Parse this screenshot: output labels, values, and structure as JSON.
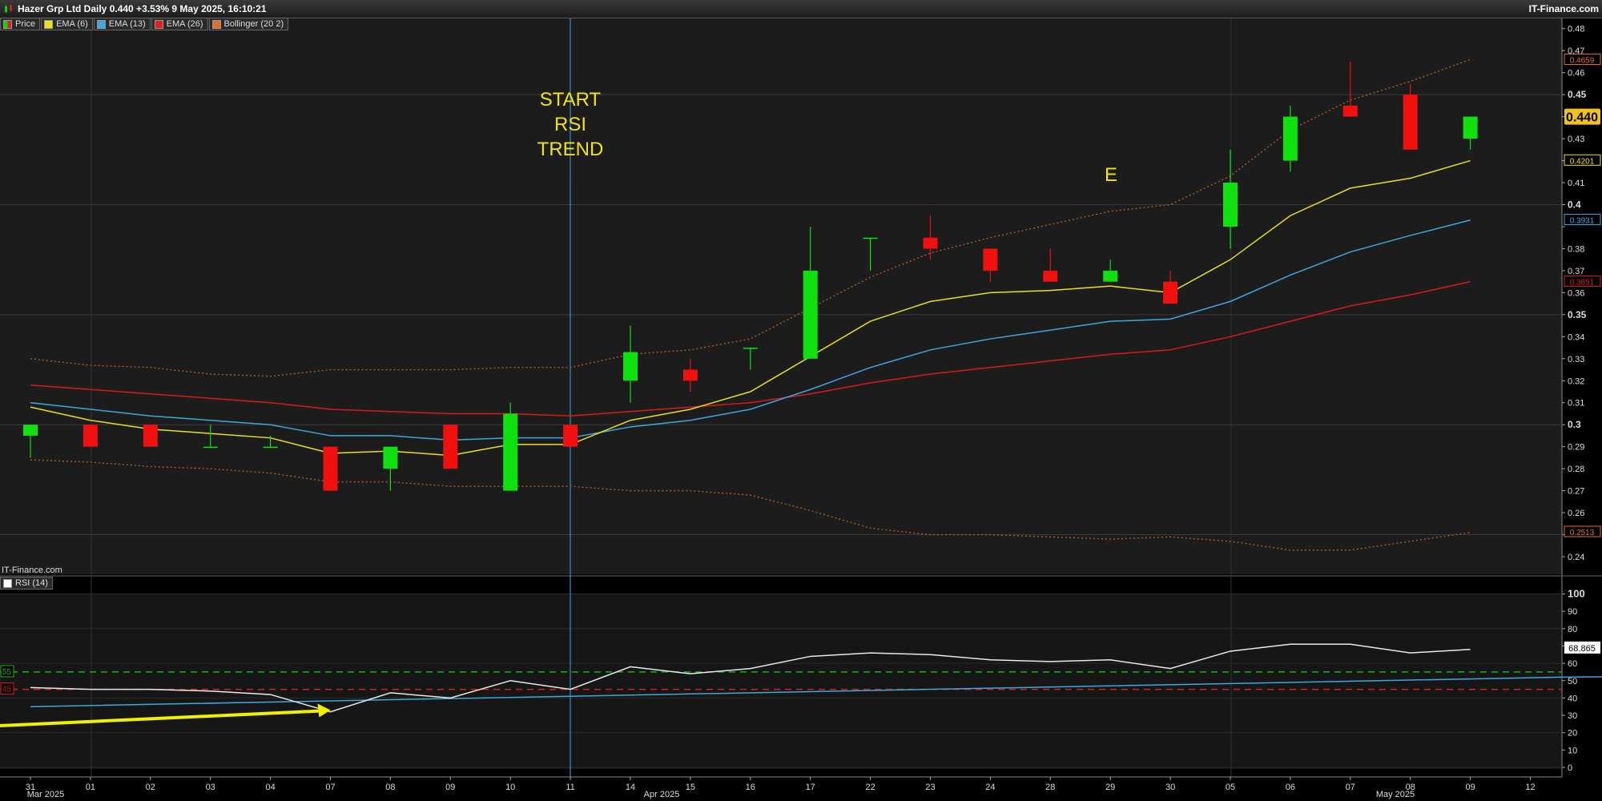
{
  "header": {
    "title": "Hazer Grp Ltd Daily 0.440 +3.53% 9 May 2025, 16:10:21",
    "brand": "IT-Finance.com"
  },
  "watermark": "IT-Finance.com",
  "legend": [
    {
      "label": "Price",
      "color": "#e0201f"
    },
    {
      "label": "EMA (6)",
      "color": "#f0e020"
    },
    {
      "label": "EMA (13)",
      "color": "#3fa8e0"
    },
    {
      "label": "EMA (26)",
      "color": "#e0201f"
    },
    {
      "label": "Bollinger (20 2)",
      "color": "#e07030"
    }
  ],
  "rsi_legend": {
    "label": "RSI (14)",
    "color": "#ffffff"
  },
  "annotations": {
    "start_line1": "START",
    "start_line2": "RSI",
    "start_line3": "TREND",
    "e_label": "E"
  },
  "colors": {
    "up": "#10e010",
    "down": "#f01010",
    "ema6": "#e8dc28",
    "ema13": "#3ea6de",
    "ema26": "#d81818",
    "bollinger": "#b05a28",
    "rsi": "#e8e8e8",
    "arrow": "#f0f000",
    "level55": "#18b018",
    "level45": "#d02020"
  },
  "chart_data": {
    "type": "candlestick",
    "title": "Hazer Grp Ltd Daily 0.440 +3.53% 9 May 2025, 16:10:21",
    "x_tick_labels": [
      "31",
      "01",
      "02",
      "03",
      "04",
      "07",
      "08",
      "09",
      "10",
      "11",
      "14",
      "15",
      "16",
      "17",
      "22",
      "23",
      "24",
      "28",
      "29",
      "30",
      "05",
      "06",
      "07",
      "08",
      "09",
      "12"
    ],
    "month_labels": [
      "Mar 2025",
      "Apr 2025",
      "May 2025"
    ],
    "price_axis": {
      "ylim": [
        0.232,
        0.485
      ],
      "ticks": [
        0.24,
        0.25,
        0.26,
        0.27,
        0.28,
        0.29,
        0.3,
        0.31,
        0.32,
        0.33,
        0.34,
        0.35,
        0.36,
        0.37,
        0.38,
        0.39,
        0.4,
        0.41,
        0.42,
        0.43,
        0.44,
        0.45,
        0.46,
        0.47,
        0.48
      ],
      "tick_labels": [
        "0.24",
        "",
        "0.26",
        "0.27",
        "0.28",
        "0.29",
        "0.3",
        "0.31",
        "0.32",
        "0.33",
        "0.34",
        "0.35",
        "0.36",
        "0.37",
        "0.38",
        "",
        "0.4",
        "0.41",
        "",
        "0.43",
        "",
        "0.45",
        "0.46",
        "0.47",
        "0.48"
      ],
      "bold_ticks": [
        0.3,
        0.35,
        0.4,
        0.45
      ],
      "grid_lines": [
        0.25,
        0.3,
        0.35,
        0.4,
        0.45
      ],
      "value_tags": [
        {
          "value": 0.4659,
          "text": "0.4659",
          "color": "#e07030",
          "style": "outline"
        },
        {
          "value": 0.44,
          "text": "0.440",
          "color": "#f0c020",
          "style": "filled"
        },
        {
          "value": 0.4201,
          "text": "0.4201",
          "color": "#f0e020",
          "style": "outline"
        },
        {
          "value": 0.3931,
          "text": "0.3931",
          "color": "#3fa8e0",
          "style": "outline"
        },
        {
          "value": 0.3651,
          "text": "0.3651",
          "color": "#e02020",
          "style": "outline"
        },
        {
          "value": 0.2513,
          "text": "0.2513",
          "color": "#e07030",
          "style": "outline"
        }
      ]
    },
    "candles": [
      {
        "date": "31",
        "open": 0.295,
        "high": 0.3,
        "low": 0.285,
        "close": 0.3
      },
      {
        "date": "01",
        "open": 0.3,
        "high": 0.3,
        "low": 0.29,
        "close": 0.29
      },
      {
        "date": "02",
        "open": 0.3,
        "high": 0.3,
        "low": 0.29,
        "close": 0.29
      },
      {
        "date": "03",
        "open": 0.29,
        "high": 0.3,
        "low": 0.29,
        "close": 0.29
      },
      {
        "date": "04",
        "open": 0.29,
        "high": 0.295,
        "low": 0.29,
        "close": 0.29
      },
      {
        "date": "07",
        "open": 0.29,
        "high": 0.29,
        "low": 0.27,
        "close": 0.27
      },
      {
        "date": "08",
        "open": 0.28,
        "high": 0.29,
        "low": 0.27,
        "close": 0.29
      },
      {
        "date": "09",
        "open": 0.3,
        "high": 0.3,
        "low": 0.28,
        "close": 0.28
      },
      {
        "date": "10",
        "open": 0.27,
        "high": 0.31,
        "low": 0.27,
        "close": 0.305
      },
      {
        "date": "11",
        "open": 0.3,
        "high": 0.3,
        "low": 0.29,
        "close": 0.29
      },
      {
        "date": "14",
        "open": 0.32,
        "high": 0.345,
        "low": 0.31,
        "close": 0.333
      },
      {
        "date": "15",
        "open": 0.325,
        "high": 0.33,
        "low": 0.315,
        "close": 0.32
      },
      {
        "date": "16",
        "open": 0.335,
        "high": 0.335,
        "low": 0.325,
        "close": 0.335
      },
      {
        "date": "17",
        "open": 0.33,
        "high": 0.39,
        "low": 0.33,
        "close": 0.37
      },
      {
        "date": "22",
        "open": 0.385,
        "high": 0.385,
        "low": 0.37,
        "close": 0.385
      },
      {
        "date": "23",
        "open": 0.385,
        "high": 0.395,
        "low": 0.375,
        "close": 0.38
      },
      {
        "date": "24",
        "open": 0.38,
        "high": 0.38,
        "low": 0.365,
        "close": 0.37
      },
      {
        "date": "28",
        "open": 0.37,
        "high": 0.38,
        "low": 0.365,
        "close": 0.365
      },
      {
        "date": "29",
        "open": 0.365,
        "high": 0.375,
        "low": 0.365,
        "close": 0.37
      },
      {
        "date": "30",
        "open": 0.365,
        "high": 0.37,
        "low": 0.355,
        "close": 0.355
      },
      {
        "date": "05",
        "open": 0.39,
        "high": 0.425,
        "low": 0.38,
        "close": 0.41
      },
      {
        "date": "06",
        "open": 0.42,
        "high": 0.445,
        "low": 0.415,
        "close": 0.44
      },
      {
        "date": "07",
        "open": 0.445,
        "high": 0.465,
        "low": 0.44,
        "close": 0.44
      },
      {
        "date": "08",
        "open": 0.45,
        "high": 0.455,
        "low": 0.425,
        "close": 0.425
      },
      {
        "date": "09",
        "open": 0.43,
        "high": 0.44,
        "low": 0.425,
        "close": 0.44
      }
    ],
    "ema6": [
      0.308,
      0.302,
      0.298,
      0.296,
      0.294,
      0.287,
      0.288,
      0.286,
      0.291,
      0.291,
      0.302,
      0.307,
      0.315,
      0.331,
      0.347,
      0.356,
      0.36,
      0.361,
      0.363,
      0.36,
      0.375,
      0.395,
      0.4075,
      0.412,
      0.42
    ],
    "ema13": [
      0.31,
      0.307,
      0.304,
      0.302,
      0.3,
      0.295,
      0.295,
      0.293,
      0.294,
      0.294,
      0.299,
      0.302,
      0.307,
      0.316,
      0.326,
      0.334,
      0.339,
      0.343,
      0.347,
      0.348,
      0.356,
      0.368,
      0.3785,
      0.386,
      0.393
    ],
    "ema26": [
      0.318,
      0.316,
      0.314,
      0.312,
      0.31,
      0.307,
      0.306,
      0.305,
      0.305,
      0.304,
      0.306,
      0.308,
      0.31,
      0.314,
      0.319,
      0.323,
      0.326,
      0.329,
      0.332,
      0.334,
      0.34,
      0.347,
      0.354,
      0.359,
      0.365
    ],
    "bollinger_upper": [
      0.33,
      0.327,
      0.326,
      0.323,
      0.322,
      0.325,
      0.325,
      0.325,
      0.326,
      0.326,
      0.332,
      0.334,
      0.339,
      0.353,
      0.367,
      0.378,
      0.385,
      0.391,
      0.397,
      0.4,
      0.413,
      0.434,
      0.4475,
      0.456,
      0.466
    ],
    "bollinger_lower": [
      0.284,
      0.283,
      0.281,
      0.28,
      0.278,
      0.274,
      0.274,
      0.272,
      0.272,
      0.272,
      0.27,
      0.27,
      0.268,
      0.261,
      0.253,
      0.25,
      0.25,
      0.249,
      0.248,
      0.249,
      0.247,
      0.243,
      0.243,
      0.247,
      0.251
    ],
    "rsi": {
      "ylim": [
        0,
        100
      ],
      "ticks": [
        0,
        10,
        20,
        30,
        40,
        50,
        60,
        70,
        80,
        90,
        100
      ],
      "levels": [
        {
          "value": 55,
          "text": "55"
        },
        {
          "value": 45,
          "text": "45"
        }
      ],
      "current_tag": {
        "value": 68.865,
        "text": "68.865"
      },
      "values": [
        46,
        45,
        45,
        44,
        42,
        32,
        43,
        40,
        50,
        45,
        58,
        54,
        57,
        64,
        66,
        65,
        62,
        61,
        62,
        57,
        67,
        71,
        71,
        66,
        68
      ],
      "signal_line": [
        [
          0,
          35
        ],
        [
          25.5,
          52
        ],
        [
          33,
          55
        ],
        [
          44.5,
          60
        ],
        [
          51,
          63
        ]
      ],
      "arrow": {
        "from": [
          0,
          24
        ],
        "to": [
          5,
          33
        ]
      }
    }
  }
}
